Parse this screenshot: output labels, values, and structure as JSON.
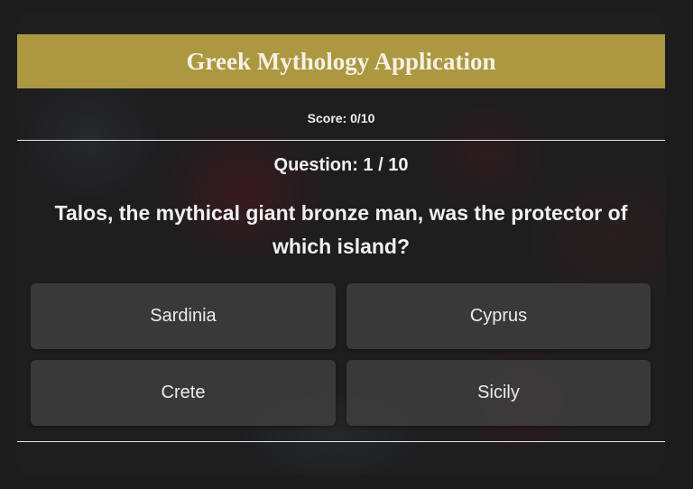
{
  "app": {
    "title": "Greek Mythology Application"
  },
  "score": {
    "text": "Score: 0/10"
  },
  "question": {
    "number_text": "Question: 1 / 10",
    "text": "Talos, the mythical giant bronze man, was the protector of which island?"
  },
  "answers": [
    {
      "label": "Sardinia"
    },
    {
      "label": "Cyprus"
    },
    {
      "label": "Crete"
    },
    {
      "label": "Sicily"
    }
  ],
  "colors": {
    "header": "#ab9840",
    "answer_bg": "#3e3e3e"
  }
}
